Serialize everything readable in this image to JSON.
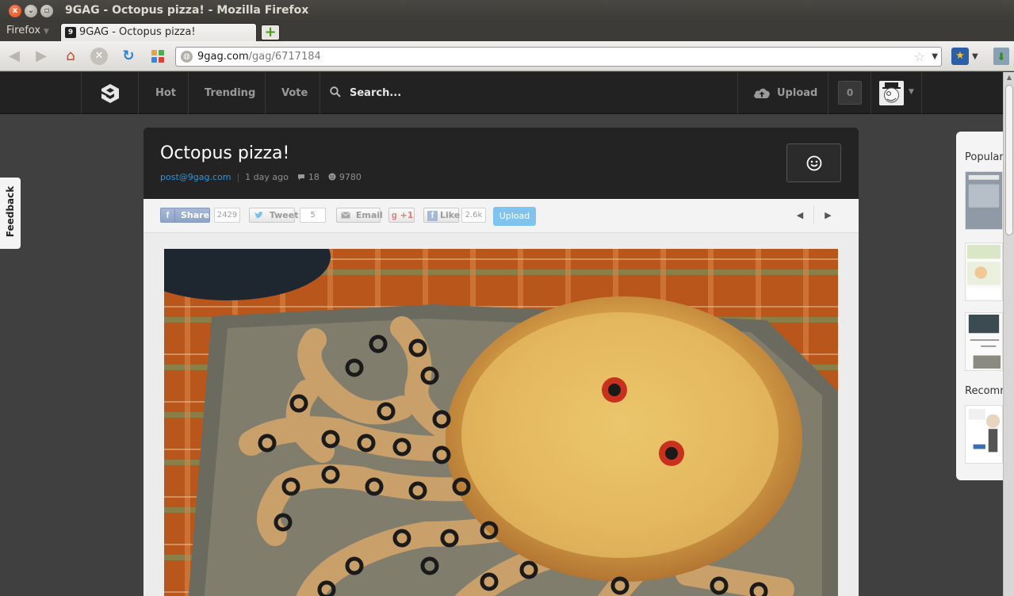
{
  "window": {
    "title": "9GAG - Octopus pizza! - Mozilla Firefox",
    "close_glyph": "x",
    "minimize_glyph": "⌄",
    "maximize_glyph": "▫"
  },
  "browser": {
    "menu_label": "Firefox",
    "menu_arrow": "▼",
    "tab_title": "9GAG - Octopus pizza!",
    "tab_favicon_glyph": "9",
    "new_tab_glyph": "+",
    "url_host": "9gag.com",
    "url_path": "/gag/6717184",
    "back_glyph": "◀",
    "forward_glyph": "▶",
    "home_glyph": "⌂",
    "stop_glyph": "✕",
    "reload_glyph": "↻",
    "globe_glyph": "◍",
    "star_glyph": "☆",
    "dropdown_glyph": "▼",
    "ext_glyph": "★",
    "ext_arrow": "▼",
    "download_glyph": "⬇",
    "apps_colors": [
      "#e8a33a",
      "#4caf50",
      "#3a86d8",
      "#d9433a"
    ]
  },
  "site": {
    "nav": {
      "hot": "Hot",
      "trending": "Trending",
      "vote": "Vote",
      "search_placeholder": "Search...",
      "upload": "Upload",
      "notification_count": "0",
      "avatar_arrow": "▼"
    },
    "feedback_label": "Feedback",
    "post": {
      "title": "Octopus pizza!",
      "author": "post@9gag.com",
      "separator": "|",
      "time": "1 day ago",
      "comments": "18",
      "points": "9780",
      "comment_glyph": "💬",
      "points_glyph": "☻"
    },
    "share": {
      "facebook_label": "Share",
      "facebook_glyph": "f",
      "facebook_count": "2429",
      "tweet_label": "Tweet",
      "tweet_glyph": "🐦",
      "tweet_count": "5",
      "email_label": "Email",
      "email_glyph": "✉",
      "gplus_label": "+1",
      "gplus_glyph": "g",
      "like_label": "Like",
      "like_glyph": "f",
      "like_count": "2.6k",
      "upload_label": "Upload",
      "prev_glyph": "◀",
      "next_glyph": "▶"
    },
    "sidebar": {
      "popular_heading": "Popular",
      "recommended_heading": "Recomm"
    },
    "colors": {
      "accent_blue": "#2f95e0",
      "upload_blue": "#7fc3ee",
      "nav_bg": "#222222",
      "page_bg": "#404040"
    },
    "icons": [
      "search-icon",
      "cloud-upload-icon",
      "smiley-icon",
      "comment-icon",
      "points-icon",
      "twitter-bird-icon",
      "email-icon",
      "facebook-icon"
    ]
  },
  "scrollbar": {
    "up_glyph": "▲"
  }
}
